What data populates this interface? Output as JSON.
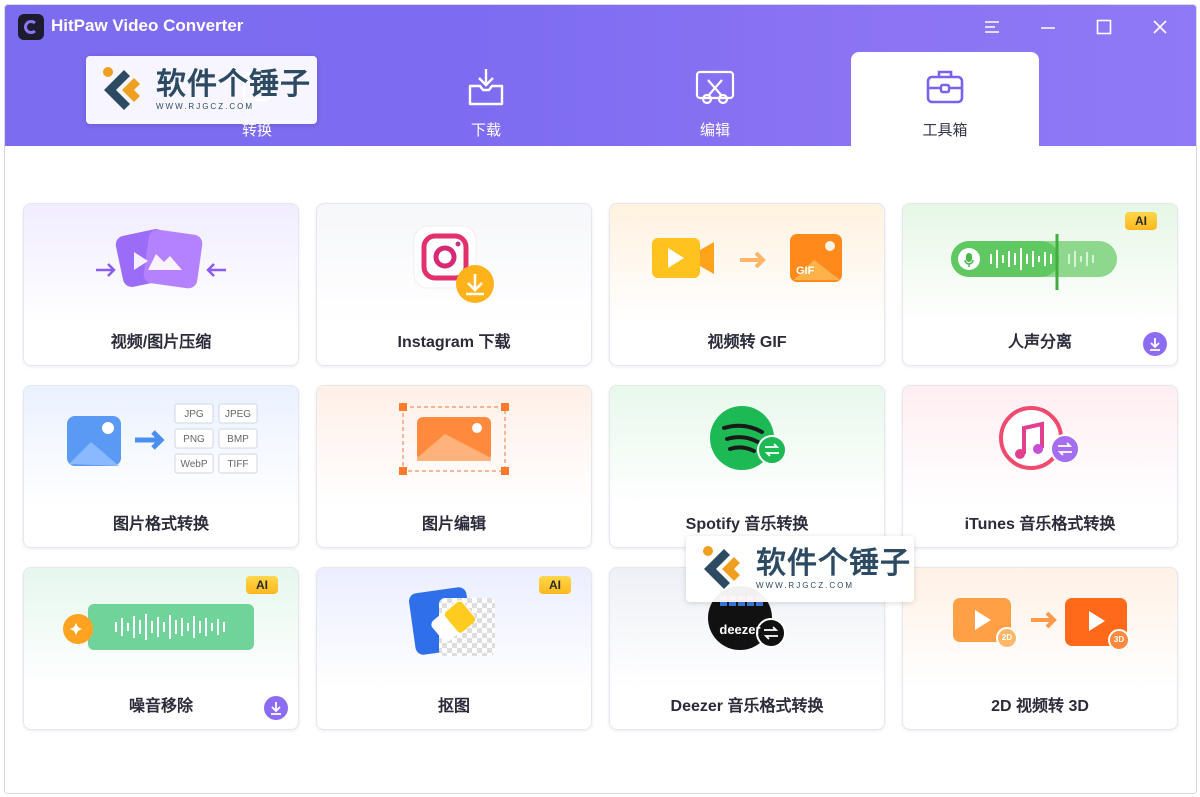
{
  "app": {
    "title": "HitPaw Video Converter"
  },
  "colors": {
    "accent": "#7c6cf0",
    "ai_badge": "#ffc533",
    "download": "#8c6cf2"
  },
  "window_controls": [
    {
      "name": "menu-icon"
    },
    {
      "name": "minimize-icon"
    },
    {
      "name": "maximize-icon"
    },
    {
      "name": "close-icon"
    }
  ],
  "tabs": [
    {
      "label": "转换",
      "icon": "convert-icon",
      "active": false
    },
    {
      "label": "下载",
      "icon": "download-tray-icon",
      "active": false
    },
    {
      "label": "编辑",
      "icon": "edit-scissors-icon",
      "active": false
    },
    {
      "label": "工具箱",
      "icon": "toolbox-icon",
      "active": true
    }
  ],
  "tools": [
    {
      "label": "视频/图片压缩",
      "icon": "compress-icon",
      "ai": false,
      "download": false
    },
    {
      "label": "Instagram 下载",
      "icon": "instagram-icon",
      "ai": false,
      "download": false
    },
    {
      "label": "视频转 GIF",
      "icon": "video-to-gif-icon",
      "ai": false,
      "download": false
    },
    {
      "label": "人声分离",
      "icon": "vocal-remover-icon",
      "ai": true,
      "download": true
    },
    {
      "label": "图片格式转换",
      "icon": "image-convert-icon",
      "ai": false,
      "download": false,
      "formats": [
        "JPG",
        "JPEG",
        "PNG",
        "BMP",
        "WebP",
        "TIFF"
      ]
    },
    {
      "label": "图片编辑",
      "icon": "image-edit-icon",
      "ai": false,
      "download": false
    },
    {
      "label": "Spotify 音乐转换",
      "icon": "spotify-icon",
      "ai": false,
      "download": false
    },
    {
      "label": "iTunes 音乐格式转换",
      "icon": "itunes-icon",
      "ai": false,
      "download": false
    },
    {
      "label": "噪音移除",
      "icon": "noise-remover-icon",
      "ai": true,
      "download": true
    },
    {
      "label": "抠图",
      "icon": "background-remover-icon",
      "ai": true,
      "download": false
    },
    {
      "label": "Deezer 音乐格式转换",
      "icon": "deezer-icon",
      "ai": false,
      "download": false,
      "logo_text": "deezer"
    },
    {
      "label": "2D 视频转 3D",
      "icon": "2d-to-3d-icon",
      "ai": false,
      "download": false,
      "tags": [
        "2D",
        "3D"
      ]
    }
  ],
  "badges": {
    "ai": "AI"
  },
  "watermark": {
    "text": "软件个锤子",
    "url": "WWW.RJGCZ.COM"
  }
}
